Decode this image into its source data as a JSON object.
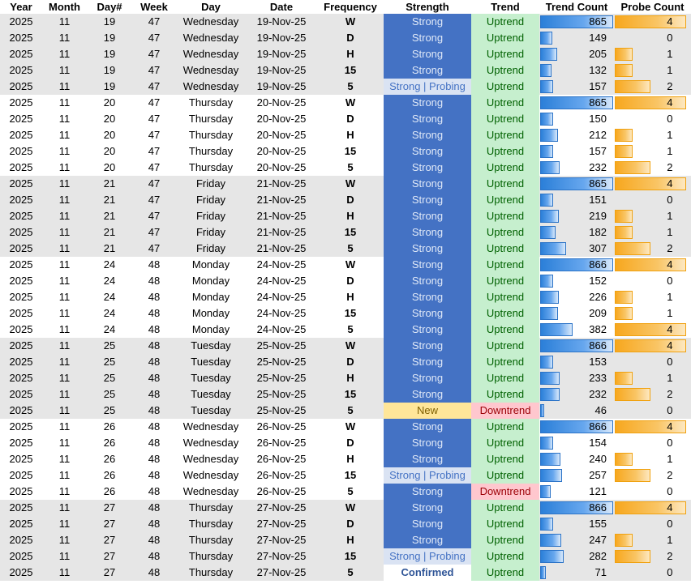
{
  "headers": [
    "Year",
    "Month",
    "Day#",
    "Week",
    "Day",
    "Date",
    "Frequency",
    "Strength",
    "Trend",
    "Trend Count",
    "Probe Count"
  ],
  "max_trend_count": 866,
  "max_probe_count": 4,
  "colors": {
    "strong": "#4472c4",
    "probing": "#dae3f3",
    "new": "#ffe699",
    "uptrend": "#c6efce",
    "downtrend": "#ffc7ce",
    "bar_blue": "#2b7fd8",
    "bar_orange": "#f7a71e"
  },
  "rows": [
    {
      "year": "2025",
      "month": "11",
      "dayn": "19",
      "week": "47",
      "day": "Wednesday",
      "date": "19-Nov-25",
      "freq": "W",
      "strength": "Strong",
      "trend": "Uptrend",
      "tc": 865,
      "pc": 4
    },
    {
      "year": "2025",
      "month": "11",
      "dayn": "19",
      "week": "47",
      "day": "Wednesday",
      "date": "19-Nov-25",
      "freq": "D",
      "strength": "Strong",
      "trend": "Uptrend",
      "tc": 149,
      "pc": 0
    },
    {
      "year": "2025",
      "month": "11",
      "dayn": "19",
      "week": "47",
      "day": "Wednesday",
      "date": "19-Nov-25",
      "freq": "H",
      "strength": "Strong",
      "trend": "Uptrend",
      "tc": 205,
      "pc": 1
    },
    {
      "year": "2025",
      "month": "11",
      "dayn": "19",
      "week": "47",
      "day": "Wednesday",
      "date": "19-Nov-25",
      "freq": "15",
      "strength": "Strong",
      "trend": "Uptrend",
      "tc": 132,
      "pc": 1
    },
    {
      "year": "2025",
      "month": "11",
      "dayn": "19",
      "week": "47",
      "day": "Wednesday",
      "date": "19-Nov-25",
      "freq": "5",
      "strength": "Strong | Probing",
      "trend": "Uptrend",
      "tc": 157,
      "pc": 2
    },
    {
      "year": "2025",
      "month": "11",
      "dayn": "20",
      "week": "47",
      "day": "Thursday",
      "date": "20-Nov-25",
      "freq": "W",
      "strength": "Strong",
      "trend": "Uptrend",
      "tc": 865,
      "pc": 4
    },
    {
      "year": "2025",
      "month": "11",
      "dayn": "20",
      "week": "47",
      "day": "Thursday",
      "date": "20-Nov-25",
      "freq": "D",
      "strength": "Strong",
      "trend": "Uptrend",
      "tc": 150,
      "pc": 0
    },
    {
      "year": "2025",
      "month": "11",
      "dayn": "20",
      "week": "47",
      "day": "Thursday",
      "date": "20-Nov-25",
      "freq": "H",
      "strength": "Strong",
      "trend": "Uptrend",
      "tc": 212,
      "pc": 1
    },
    {
      "year": "2025",
      "month": "11",
      "dayn": "20",
      "week": "47",
      "day": "Thursday",
      "date": "20-Nov-25",
      "freq": "15",
      "strength": "Strong",
      "trend": "Uptrend",
      "tc": 157,
      "pc": 1
    },
    {
      "year": "2025",
      "month": "11",
      "dayn": "20",
      "week": "47",
      "day": "Thursday",
      "date": "20-Nov-25",
      "freq": "5",
      "strength": "Strong",
      "trend": "Uptrend",
      "tc": 232,
      "pc": 2
    },
    {
      "year": "2025",
      "month": "11",
      "dayn": "21",
      "week": "47",
      "day": "Friday",
      "date": "21-Nov-25",
      "freq": "W",
      "strength": "Strong",
      "trend": "Uptrend",
      "tc": 865,
      "pc": 4
    },
    {
      "year": "2025",
      "month": "11",
      "dayn": "21",
      "week": "47",
      "day": "Friday",
      "date": "21-Nov-25",
      "freq": "D",
      "strength": "Strong",
      "trend": "Uptrend",
      "tc": 151,
      "pc": 0
    },
    {
      "year": "2025",
      "month": "11",
      "dayn": "21",
      "week": "47",
      "day": "Friday",
      "date": "21-Nov-25",
      "freq": "H",
      "strength": "Strong",
      "trend": "Uptrend",
      "tc": 219,
      "pc": 1
    },
    {
      "year": "2025",
      "month": "11",
      "dayn": "21",
      "week": "47",
      "day": "Friday",
      "date": "21-Nov-25",
      "freq": "15",
      "strength": "Strong",
      "trend": "Uptrend",
      "tc": 182,
      "pc": 1
    },
    {
      "year": "2025",
      "month": "11",
      "dayn": "21",
      "week": "47",
      "day": "Friday",
      "date": "21-Nov-25",
      "freq": "5",
      "strength": "Strong",
      "trend": "Uptrend",
      "tc": 307,
      "pc": 2
    },
    {
      "year": "2025",
      "month": "11",
      "dayn": "24",
      "week": "48",
      "day": "Monday",
      "date": "24-Nov-25",
      "freq": "W",
      "strength": "Strong",
      "trend": "Uptrend",
      "tc": 866,
      "pc": 4
    },
    {
      "year": "2025",
      "month": "11",
      "dayn": "24",
      "week": "48",
      "day": "Monday",
      "date": "24-Nov-25",
      "freq": "D",
      "strength": "Strong",
      "trend": "Uptrend",
      "tc": 152,
      "pc": 0
    },
    {
      "year": "2025",
      "month": "11",
      "dayn": "24",
      "week": "48",
      "day": "Monday",
      "date": "24-Nov-25",
      "freq": "H",
      "strength": "Strong",
      "trend": "Uptrend",
      "tc": 226,
      "pc": 1
    },
    {
      "year": "2025",
      "month": "11",
      "dayn": "24",
      "week": "48",
      "day": "Monday",
      "date": "24-Nov-25",
      "freq": "15",
      "strength": "Strong",
      "trend": "Uptrend",
      "tc": 209,
      "pc": 1
    },
    {
      "year": "2025",
      "month": "11",
      "dayn": "24",
      "week": "48",
      "day": "Monday",
      "date": "24-Nov-25",
      "freq": "5",
      "strength": "Strong",
      "trend": "Uptrend",
      "tc": 382,
      "pc": 4
    },
    {
      "year": "2025",
      "month": "11",
      "dayn": "25",
      "week": "48",
      "day": "Tuesday",
      "date": "25-Nov-25",
      "freq": "W",
      "strength": "Strong",
      "trend": "Uptrend",
      "tc": 866,
      "pc": 4
    },
    {
      "year": "2025",
      "month": "11",
      "dayn": "25",
      "week": "48",
      "day": "Tuesday",
      "date": "25-Nov-25",
      "freq": "D",
      "strength": "Strong",
      "trend": "Uptrend",
      "tc": 153,
      "pc": 0
    },
    {
      "year": "2025",
      "month": "11",
      "dayn": "25",
      "week": "48",
      "day": "Tuesday",
      "date": "25-Nov-25",
      "freq": "H",
      "strength": "Strong",
      "trend": "Uptrend",
      "tc": 233,
      "pc": 1
    },
    {
      "year": "2025",
      "month": "11",
      "dayn": "25",
      "week": "48",
      "day": "Tuesday",
      "date": "25-Nov-25",
      "freq": "15",
      "strength": "Strong",
      "trend": "Uptrend",
      "tc": 232,
      "pc": 2
    },
    {
      "year": "2025",
      "month": "11",
      "dayn": "25",
      "week": "48",
      "day": "Tuesday",
      "date": "25-Nov-25",
      "freq": "5",
      "strength": "New",
      "trend": "Downtrend",
      "tc": 46,
      "pc": 0
    },
    {
      "year": "2025",
      "month": "11",
      "dayn": "26",
      "week": "48",
      "day": "Wednesday",
      "date": "26-Nov-25",
      "freq": "W",
      "strength": "Strong",
      "trend": "Uptrend",
      "tc": 866,
      "pc": 4
    },
    {
      "year": "2025",
      "month": "11",
      "dayn": "26",
      "week": "48",
      "day": "Wednesday",
      "date": "26-Nov-25",
      "freq": "D",
      "strength": "Strong",
      "trend": "Uptrend",
      "tc": 154,
      "pc": 0
    },
    {
      "year": "2025",
      "month": "11",
      "dayn": "26",
      "week": "48",
      "day": "Wednesday",
      "date": "26-Nov-25",
      "freq": "H",
      "strength": "Strong",
      "trend": "Uptrend",
      "tc": 240,
      "pc": 1
    },
    {
      "year": "2025",
      "month": "11",
      "dayn": "26",
      "week": "48",
      "day": "Wednesday",
      "date": "26-Nov-25",
      "freq": "15",
      "strength": "Strong | Probing",
      "trend": "Uptrend",
      "tc": 257,
      "pc": 2
    },
    {
      "year": "2025",
      "month": "11",
      "dayn": "26",
      "week": "48",
      "day": "Wednesday",
      "date": "26-Nov-25",
      "freq": "5",
      "strength": "Strong",
      "trend": "Downtrend",
      "tc": 121,
      "pc": 0
    },
    {
      "year": "2025",
      "month": "11",
      "dayn": "27",
      "week": "48",
      "day": "Thursday",
      "date": "27-Nov-25",
      "freq": "W",
      "strength": "Strong",
      "trend": "Uptrend",
      "tc": 866,
      "pc": 4
    },
    {
      "year": "2025",
      "month": "11",
      "dayn": "27",
      "week": "48",
      "day": "Thursday",
      "date": "27-Nov-25",
      "freq": "D",
      "strength": "Strong",
      "trend": "Uptrend",
      "tc": 155,
      "pc": 0
    },
    {
      "year": "2025",
      "month": "11",
      "dayn": "27",
      "week": "48",
      "day": "Thursday",
      "date": "27-Nov-25",
      "freq": "H",
      "strength": "Strong",
      "trend": "Uptrend",
      "tc": 247,
      "pc": 1
    },
    {
      "year": "2025",
      "month": "11",
      "dayn": "27",
      "week": "48",
      "day": "Thursday",
      "date": "27-Nov-25",
      "freq": "15",
      "strength": "Strong | Probing",
      "trend": "Uptrend",
      "tc": 282,
      "pc": 2
    },
    {
      "year": "2025",
      "month": "11",
      "dayn": "27",
      "week": "48",
      "day": "Thursday",
      "date": "27-Nov-25",
      "freq": "5",
      "strength": "Confirmed",
      "trend": "Uptrend",
      "tc": 71,
      "pc": 0
    }
  ]
}
